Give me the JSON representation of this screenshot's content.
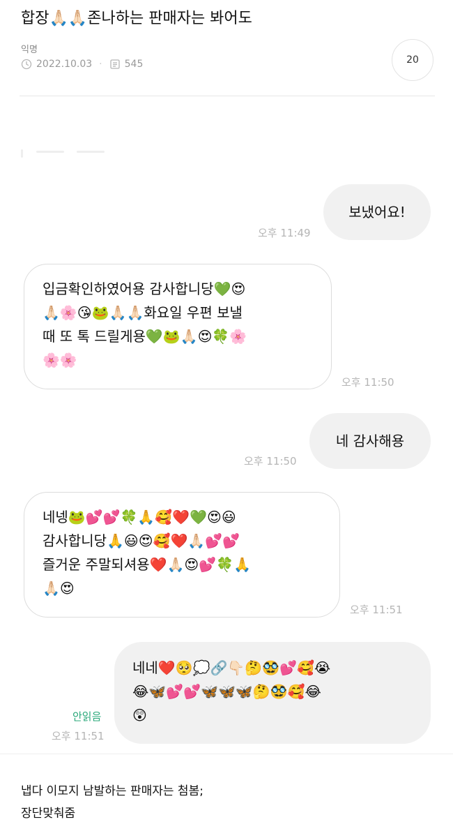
{
  "post": {
    "title": "합장🙏🏻🙏🏻존나하는 판매자는 봐어도",
    "author": "익명",
    "date": "2022.10.03",
    "views": "545",
    "comment_count": "20",
    "icons": {
      "clock": "clock-icon",
      "views": "views-icon"
    }
  },
  "messages": [
    {
      "direction": "out",
      "lines": [
        "보냈어요!"
      ],
      "time": "오후 11:49"
    },
    {
      "direction": "in",
      "lines": [
        "입금확인하였어용 감사합니당💚😍",
        "🙏🏻🌸😘🐸🙏🏻🙏🏻화요일 우편 보낼",
        "때 또 톡 드릴게용💚🐸🙏🏻😍🍀🌸",
        "🌸🌸"
      ],
      "time": "오후 11:50"
    },
    {
      "direction": "out",
      "lines": [
        "네 감사해용"
      ],
      "time": "오후 11:50"
    },
    {
      "direction": "in",
      "lines": [
        "네넹🐸💕💕🍀🙏🥰❤️💚😍😃",
        "감사합니당🙏😃😍🥰❤️🙏🏻💕💕",
        "즐거운 주말되셔용❤️🙏🏻😍💕🍀🙏",
        "🙏🏻😍"
      ],
      "time": "오후 11:51"
    },
    {
      "direction": "out",
      "lines": [
        "네네❤️🥺💭🔗👇🏻🤔🥸💕🥰😭",
        "😂🦋💕💕🦋🦋🦋🤔🥸🥰😂",
        "😲"
      ],
      "time": "오후 11:51",
      "status": "안읽음"
    }
  ],
  "caption": {
    "line1": "냅다 이모지 남발하는 판매자는 첨봄;",
    "line2": "장단맞춰줌"
  }
}
